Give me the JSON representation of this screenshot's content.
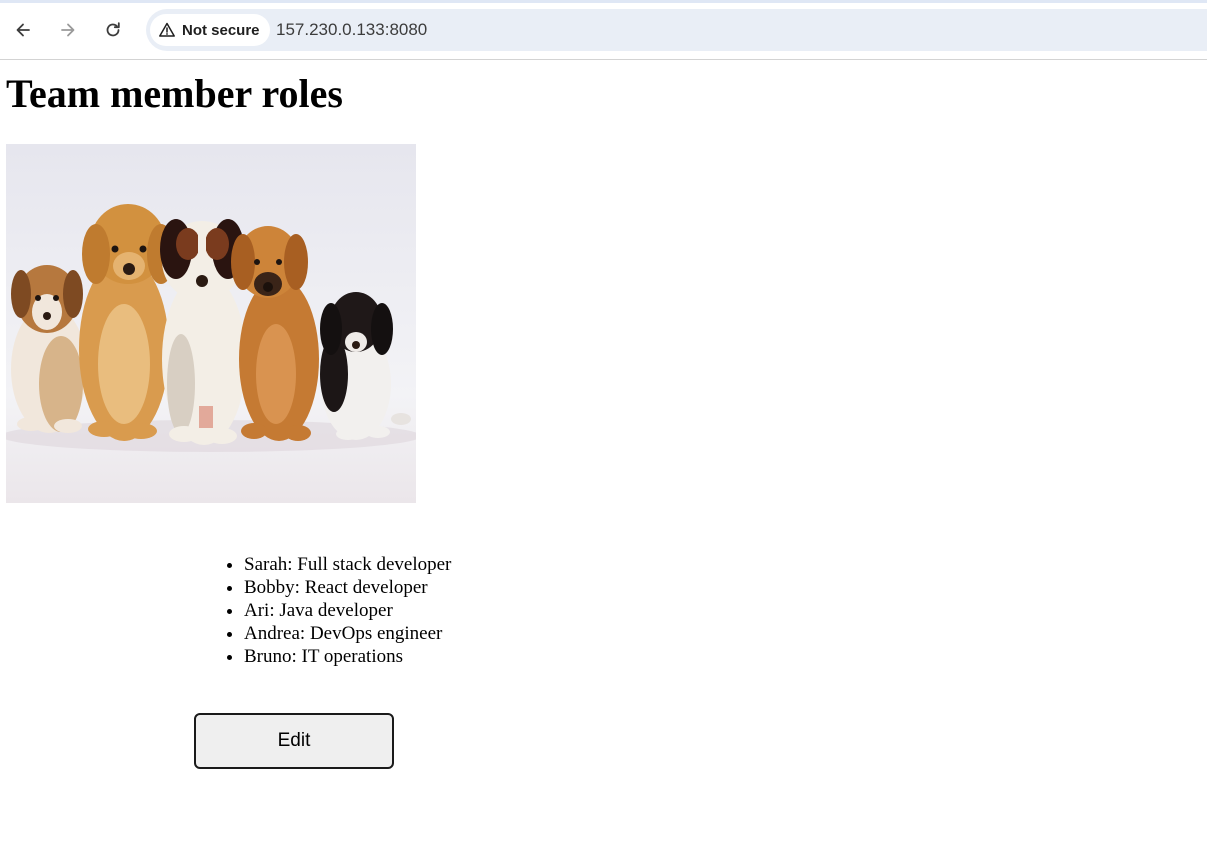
{
  "browser": {
    "security_label": "Not secure",
    "url": "157.230.0.133:8080",
    "icons": [
      "back-arrow-icon",
      "forward-arrow-icon",
      "reload-icon",
      "warning-triangle-icon"
    ]
  },
  "page": {
    "title": "Team member roles",
    "photo": {
      "alt": "five puppies sitting in a row"
    },
    "roles": [
      "Sarah: Full stack developer",
      "Bobby: React developer",
      "Ari: Java developer",
      "Andrea: DevOps engineer",
      "Bruno: IT operations"
    ],
    "edit_label": "Edit"
  },
  "colors": {
    "omnibox_bg": "#e9eef6",
    "button_bg": "#efefef"
  }
}
